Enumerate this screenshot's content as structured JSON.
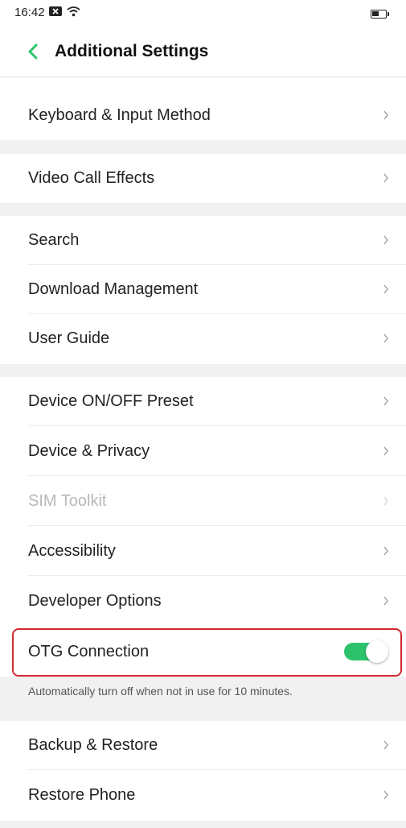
{
  "status_bar": {
    "time": "16:42",
    "battery_level_fraction": 0.55
  },
  "header": {
    "title": "Additional Settings",
    "accent_color": "#2cc36c"
  },
  "groups": [
    {
      "items": [
        {
          "label": "Keyboard & Input Method"
        }
      ]
    },
    {
      "items": [
        {
          "label": "Video Call Effects"
        }
      ]
    },
    {
      "items": [
        {
          "label": "Search"
        },
        {
          "label": "Download Management"
        },
        {
          "label": "User Guide"
        }
      ]
    },
    {
      "items": [
        {
          "label": "Device ON/OFF Preset"
        },
        {
          "label": "Device & Privacy"
        },
        {
          "label": "SIM Toolkit",
          "disabled": true
        },
        {
          "label": "Accessibility"
        },
        {
          "label": "Developer Options"
        }
      ]
    }
  ],
  "otg": {
    "label": "OTG Connection",
    "enabled": true,
    "note": "Automatically turn off when not in use for 10 minutes.",
    "highlight_color": "#d22a33"
  },
  "bottom_group": {
    "items": [
      {
        "label": "Backup & Restore"
      },
      {
        "label": "Restore Phone"
      }
    ]
  }
}
